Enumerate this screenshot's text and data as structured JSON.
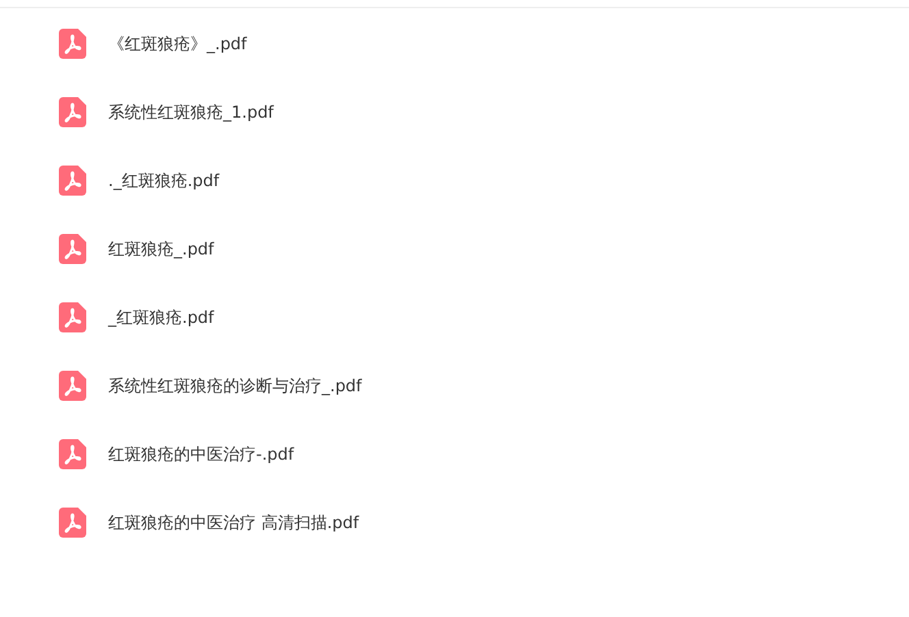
{
  "files": [
    {
      "name": "《红斑狼疮》_.pdf"
    },
    {
      "name": "系统性红斑狼疮_1.pdf"
    },
    {
      "name": "._红斑狼疮.pdf"
    },
    {
      "name": "红斑狼疮_.pdf"
    },
    {
      "name": "_红斑狼疮.pdf"
    },
    {
      "name": "系统性红斑狼疮的诊断与治疗_.pdf"
    },
    {
      "name": "红斑狼疮的中医治疗-.pdf"
    },
    {
      "name": "红斑狼疮的中医治疗 高清扫描.pdf"
    }
  ]
}
